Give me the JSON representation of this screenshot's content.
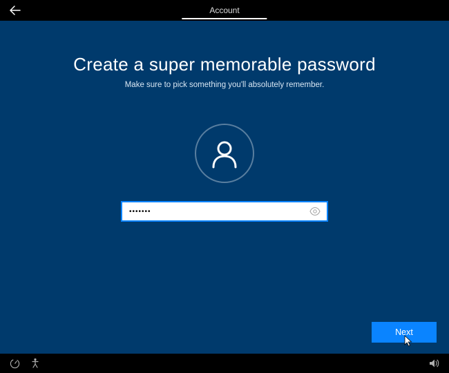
{
  "tab": {
    "label": "Account"
  },
  "heading": "Create a super memorable password",
  "subheading": "Make sure to pick something you'll absolutely remember.",
  "password": {
    "masked": "•••••••"
  },
  "buttons": {
    "next": "Next"
  },
  "icons": {
    "back": "back-arrow-icon",
    "avatar": "user-icon",
    "reveal": "eye-icon",
    "ease": "ease-of-access-icon",
    "pin": "pin-icon",
    "volume": "volume-icon"
  },
  "colors": {
    "background": "#003a6c",
    "accent": "#0a84ff"
  }
}
